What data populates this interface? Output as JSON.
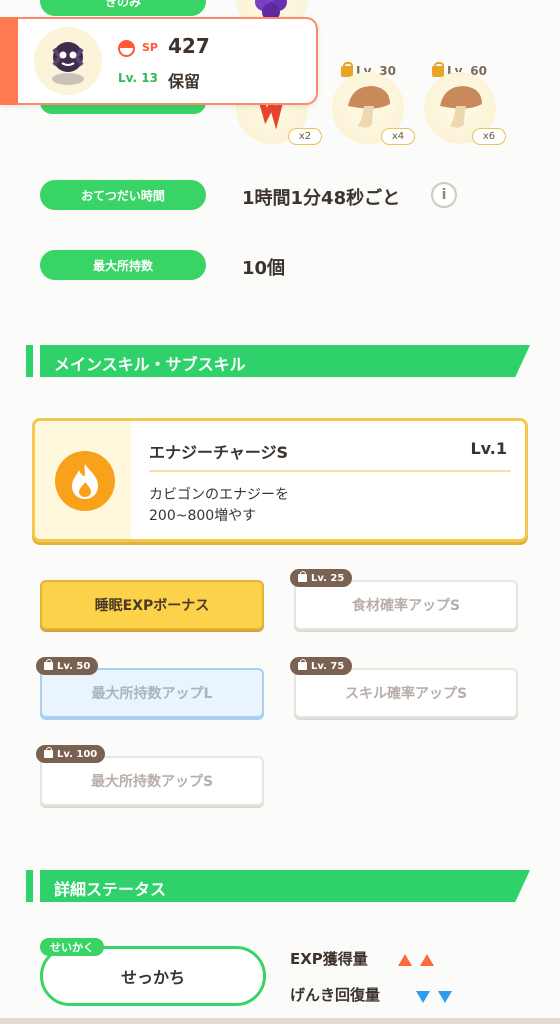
{
  "berry": {
    "label": "きのみ"
  },
  "pokemon_card": {
    "sp_label": "SP",
    "sp_value": "427",
    "level": "Lv. 13",
    "status": "保留"
  },
  "ingredients": [
    {
      "level_label": "",
      "quantity": "x2",
      "icon": "red-berry-cluster"
    },
    {
      "level_label": "Lv. 30",
      "quantity": "x4",
      "icon": "mushroom-icon"
    },
    {
      "level_label": "Lv. 60",
      "quantity": "x6",
      "icon": "mushroom-icon"
    }
  ],
  "help_time": {
    "label": "おてつだい時間",
    "value": "1時間1分48秒ごと"
  },
  "max_carry": {
    "label": "最大所持数",
    "value": "10個"
  },
  "skills_section": {
    "title": "メインスキル・サブスキル"
  },
  "main_skill": {
    "name": "エナジーチャージS",
    "level": "Lv.1",
    "desc_line1": "カビゴンのエナジーを",
    "desc_line2": "200~800増やす"
  },
  "sub_skills": [
    {
      "label": "睡眠EXPボーナス",
      "lock": ""
    },
    {
      "label": "食材確率アップS",
      "lock": "Lv. 25"
    },
    {
      "label": "最大所持数アップL",
      "lock": "Lv. 50"
    },
    {
      "label": "スキル確率アップS",
      "lock": "Lv. 75"
    },
    {
      "label": "最大所持数アップS",
      "lock": "Lv. 100"
    }
  ],
  "status_section": {
    "title": "詳細ステータス"
  },
  "nature": {
    "tag": "せいかく",
    "value": "せっかち"
  },
  "stats": {
    "exp_label": "EXP獲得量",
    "energy_label": "げんき回復量"
  },
  "colors": {
    "accent_green": "#2fd26a",
    "card_border": "#ff8a6a",
    "gold": "#fcd24b",
    "up_arrow": "#ff6a3c",
    "down_arrow": "#2e9cf0"
  }
}
